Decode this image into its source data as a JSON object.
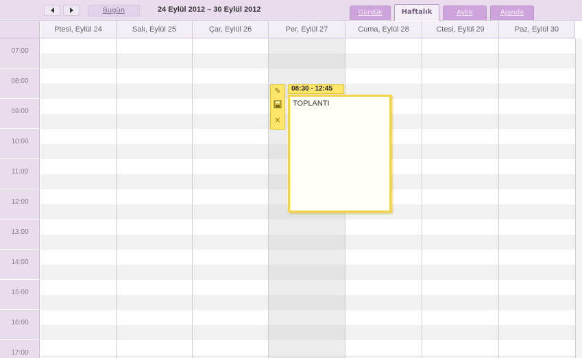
{
  "toolbar": {
    "prev_icon": "chevron-left",
    "next_icon": "chevron-right",
    "today_label": "Bugün",
    "date_range": "24 Eylül 2012 – 30 Eylül 2012",
    "views": [
      {
        "label": "Günlük",
        "active": false
      },
      {
        "label": "Haftalık",
        "active": true
      },
      {
        "label": "Aylık",
        "active": false
      },
      {
        "label": "Ajanda",
        "active": false
      }
    ]
  },
  "days": [
    "Ptesi, Eylül 24",
    "Salı, Eylül 25",
    "Çar, Eylül 26",
    "Per, Eylül 27",
    "Cuma, Eylül 28",
    "Ctesi, Eylül 29",
    "Paz, Eylül 30"
  ],
  "hours": [
    "07:00",
    "08:00",
    "09:00",
    "10:00",
    "11:00",
    "12:00",
    "13:00",
    "14:00",
    "15:00",
    "16:00",
    "17:00"
  ],
  "event": {
    "time": "08:30 - 12:45",
    "title": "TOPLANTI",
    "tools": [
      "pencil-icon",
      "save-icon",
      "delete-icon"
    ]
  },
  "colors": {
    "accent": "#cfa4dc",
    "header_bg": "#e8dced",
    "event_yellow": "#ffe66a"
  }
}
